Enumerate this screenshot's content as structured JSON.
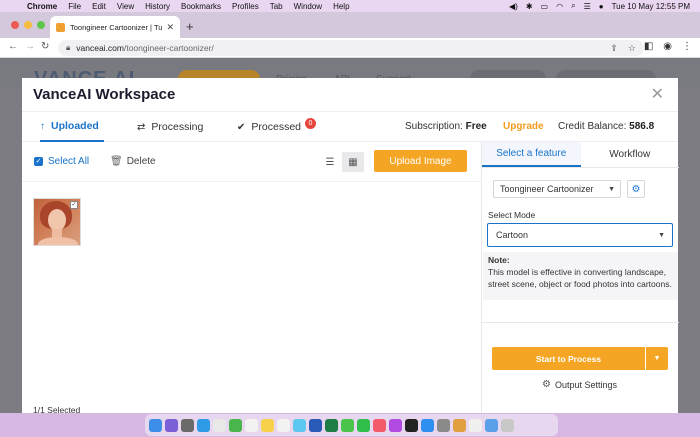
{
  "menubar": {
    "items": [
      "Chrome",
      "File",
      "Edit",
      "View",
      "History",
      "Bookmarks",
      "Profiles",
      "Tab",
      "Window",
      "Help"
    ],
    "clock": "Tue 10 May  12:55 PM"
  },
  "browser": {
    "tab_title": "Toongineer Cartoonizer | Turn",
    "url_host": "vanceai.com",
    "url_path": "/toongineer-cartoonizer/"
  },
  "site": {
    "logo": "VANCE AI",
    "nav": [
      "Pricing",
      "API",
      "Support"
    ]
  },
  "modal": {
    "title": "VanceAI Workspace",
    "tabs": {
      "uploaded": "Uploaded",
      "processing": "Processing",
      "processed": "Processed",
      "processed_badge": "0"
    },
    "subscription_label": "Subscription:",
    "subscription_value": "Free",
    "upgrade": "Upgrade",
    "credit_label": "Credit Balance:",
    "credit_value": "586.8"
  },
  "toolbar": {
    "select_all": "Select All",
    "delete": "Delete",
    "upload": "Upload Image"
  },
  "files": {
    "selected_count": "1/1   Selected"
  },
  "right_panel": {
    "tab_feature": "Select a feature",
    "tab_workflow": "Workflow",
    "feature_value": "Toongineer Cartoonizer",
    "mode_label": "Select Mode",
    "mode_value": "Cartoon",
    "note_title": "Note:",
    "note_text": "This model is effective in converting landscape, street scene, object or food photos into cartoons.",
    "start_button": "Start to Process",
    "output_settings": "Output Settings"
  },
  "colors": {
    "accent_blue": "#1a73c9",
    "accent_orange": "#f5a524",
    "badge_red": "#e8453c"
  }
}
